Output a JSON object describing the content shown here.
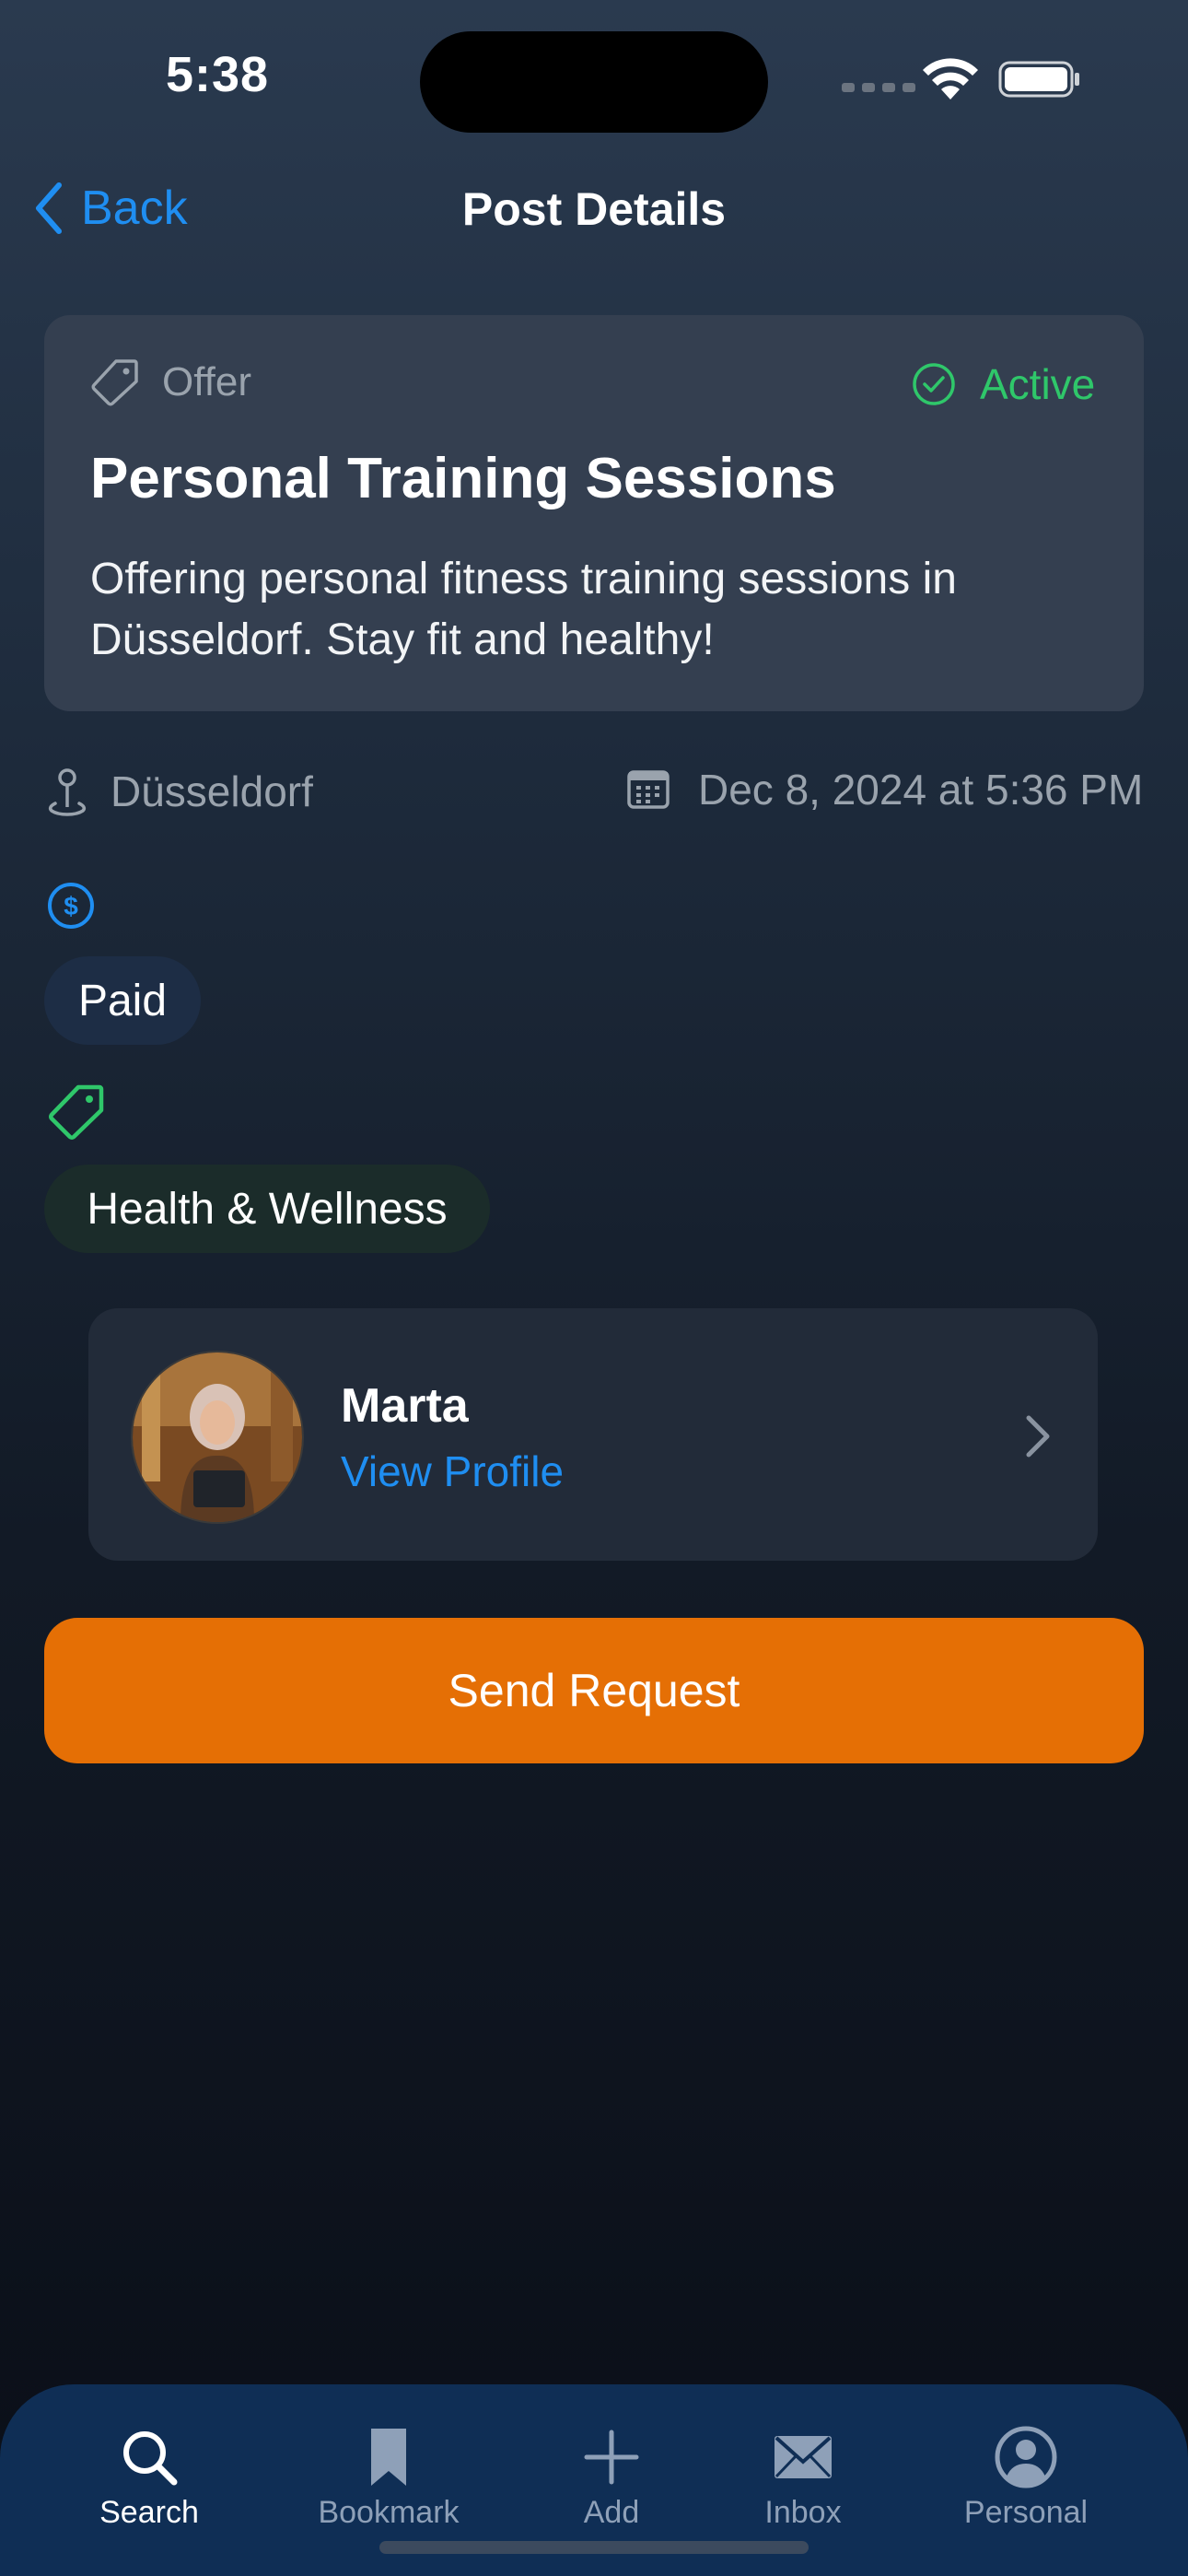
{
  "status_bar": {
    "time": "5:38",
    "icons": [
      "signal-icon",
      "wifi-icon",
      "battery-icon"
    ]
  },
  "nav": {
    "back_label": "Back",
    "title": "Post Details"
  },
  "post": {
    "type_label": "Offer",
    "status_label": "Active",
    "title": "Personal Training Sessions",
    "description": "Offering personal fitness training sessions in Düsseldorf. Stay fit and healthy!",
    "location": "Düsseldorf",
    "date": "Dec 8, 2024 at 5:36 PM",
    "price_chip": "Paid",
    "category_chip": "Health & Wellness"
  },
  "author": {
    "name": "Marta",
    "link": "View Profile"
  },
  "actions": {
    "send_request": "Send Request"
  },
  "tabs": [
    {
      "label": "Search",
      "icon": "search-icon",
      "selected": true
    },
    {
      "label": "Bookmark",
      "icon": "bookmark-icon",
      "selected": false
    },
    {
      "label": "Add",
      "icon": "plus-icon",
      "selected": false
    },
    {
      "label": "Inbox",
      "icon": "envelope-icon",
      "selected": false
    },
    {
      "label": "Personal",
      "icon": "person-circle-icon",
      "selected": false
    }
  ],
  "colors": {
    "accent_blue": "#1f8ef1",
    "active_green": "#2fc76a",
    "button_orange": "#e56f05",
    "tabbar": "#0f2e55"
  }
}
